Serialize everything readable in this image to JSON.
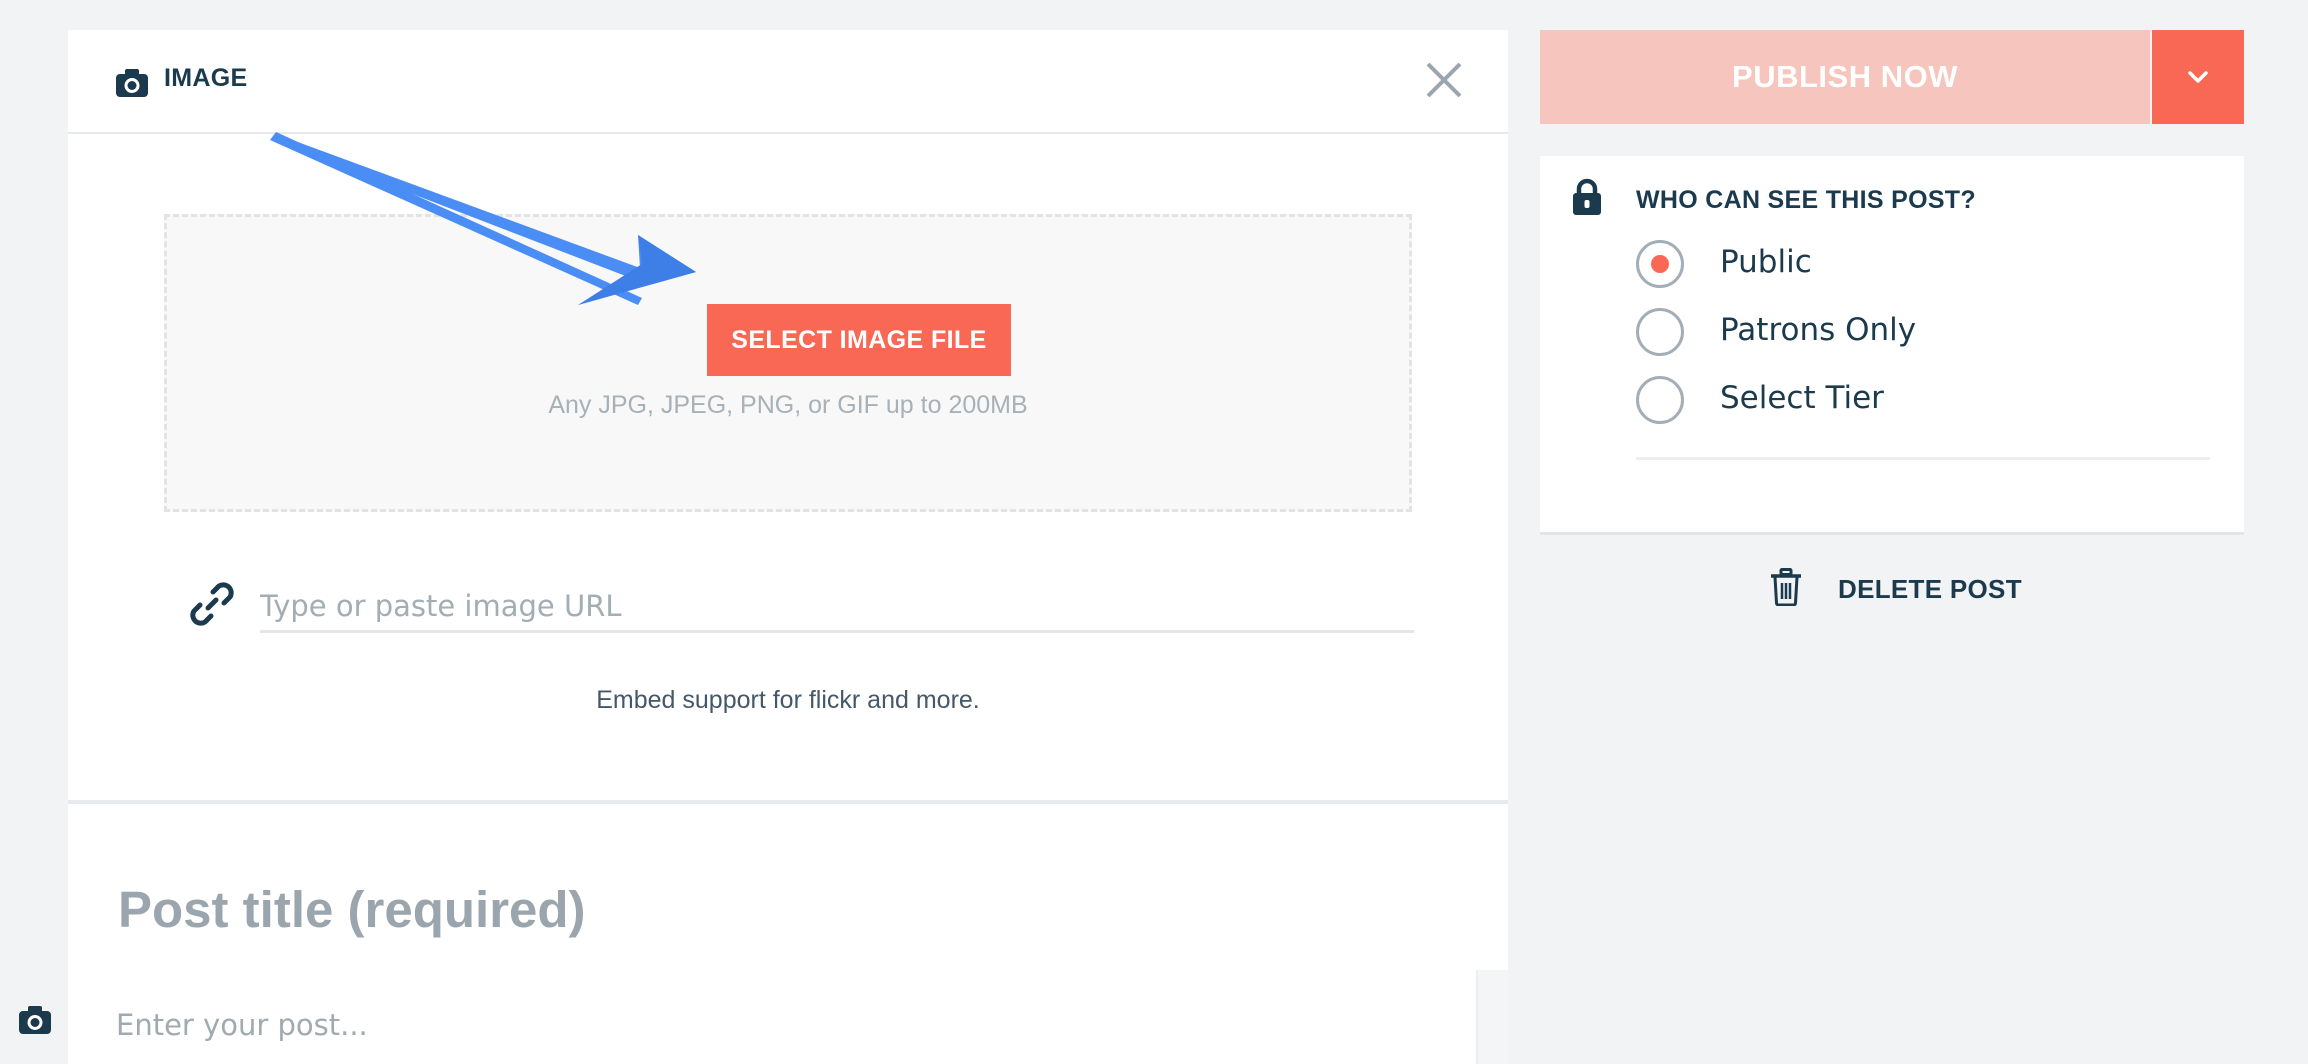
{
  "image_block": {
    "title": "IMAGE",
    "select_button_label": "SELECT IMAGE FILE",
    "file_hint": "Any JPG, JPEG, PNG, or GIF up to 200MB",
    "url_placeholder": "Type or paste image URL",
    "url_value": "",
    "embed_hint": "Embed support for flickr and more."
  },
  "post": {
    "title_placeholder": "Post title (required)",
    "body_placeholder": "Enter your post..."
  },
  "publish": {
    "label": "PUBLISH NOW"
  },
  "visibility": {
    "heading": "WHO CAN SEE THIS POST?",
    "options": [
      {
        "label": "Public",
        "selected": true
      },
      {
        "label": "Patrons Only",
        "selected": false
      },
      {
        "label": "Select Tier",
        "selected": false
      }
    ]
  },
  "delete_post": {
    "label": "DELETE POST"
  },
  "colors": {
    "accent": "#f96854",
    "publish_disabled": "#f6c5be",
    "text_dark": "#1b3a4d",
    "annotation_arrow": "#4a8ef5"
  },
  "icons": [
    "camera-icon",
    "close-icon",
    "link-icon",
    "chevron-down-icon",
    "lock-icon",
    "trash-icon",
    "annotation-arrow"
  ]
}
